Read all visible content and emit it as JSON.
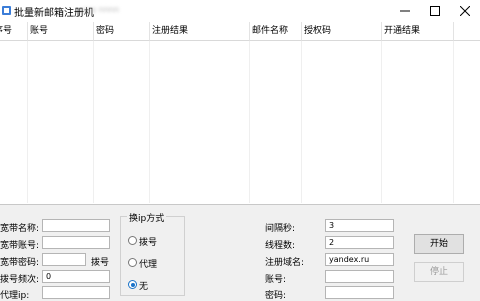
{
  "window": {
    "title": "批量新邮箱注册机",
    "title_suffix": "yyy nnnn"
  },
  "grid": {
    "columns": [
      "序号",
      "账号",
      "密码",
      "注册结果",
      "邮件名称",
      "授权码",
      "开通结果"
    ]
  },
  "broadband": {
    "name_label": "宽带名称:",
    "name_value": "",
    "account_label": "宽带账号:",
    "account_value": "",
    "password_label": "宽带密码:",
    "password_value": "",
    "dial_label": "拨号",
    "dial_freq_label": "拨号频次:",
    "dial_freq_value": "0",
    "proxy_ip_label": "代理ip:",
    "proxy_ip_value": ""
  },
  "ip_mode": {
    "title": "换ip方式",
    "options": [
      "拨号",
      "代理",
      "无"
    ],
    "selected": "无"
  },
  "settings": {
    "interval_label": "间隔秒:",
    "interval_value": "3",
    "threads_label": "线程数:",
    "threads_value": "2",
    "domain_label": "注册域名:",
    "domain_value": "yandex.ru",
    "account_label": "账号:",
    "account_value": "",
    "password_label": "密码:",
    "password_value": ""
  },
  "actions": {
    "start": "开始",
    "stop": "停止"
  },
  "colors": {
    "accent": "#1a73c9",
    "disabled_text": "#9a9a9a"
  }
}
